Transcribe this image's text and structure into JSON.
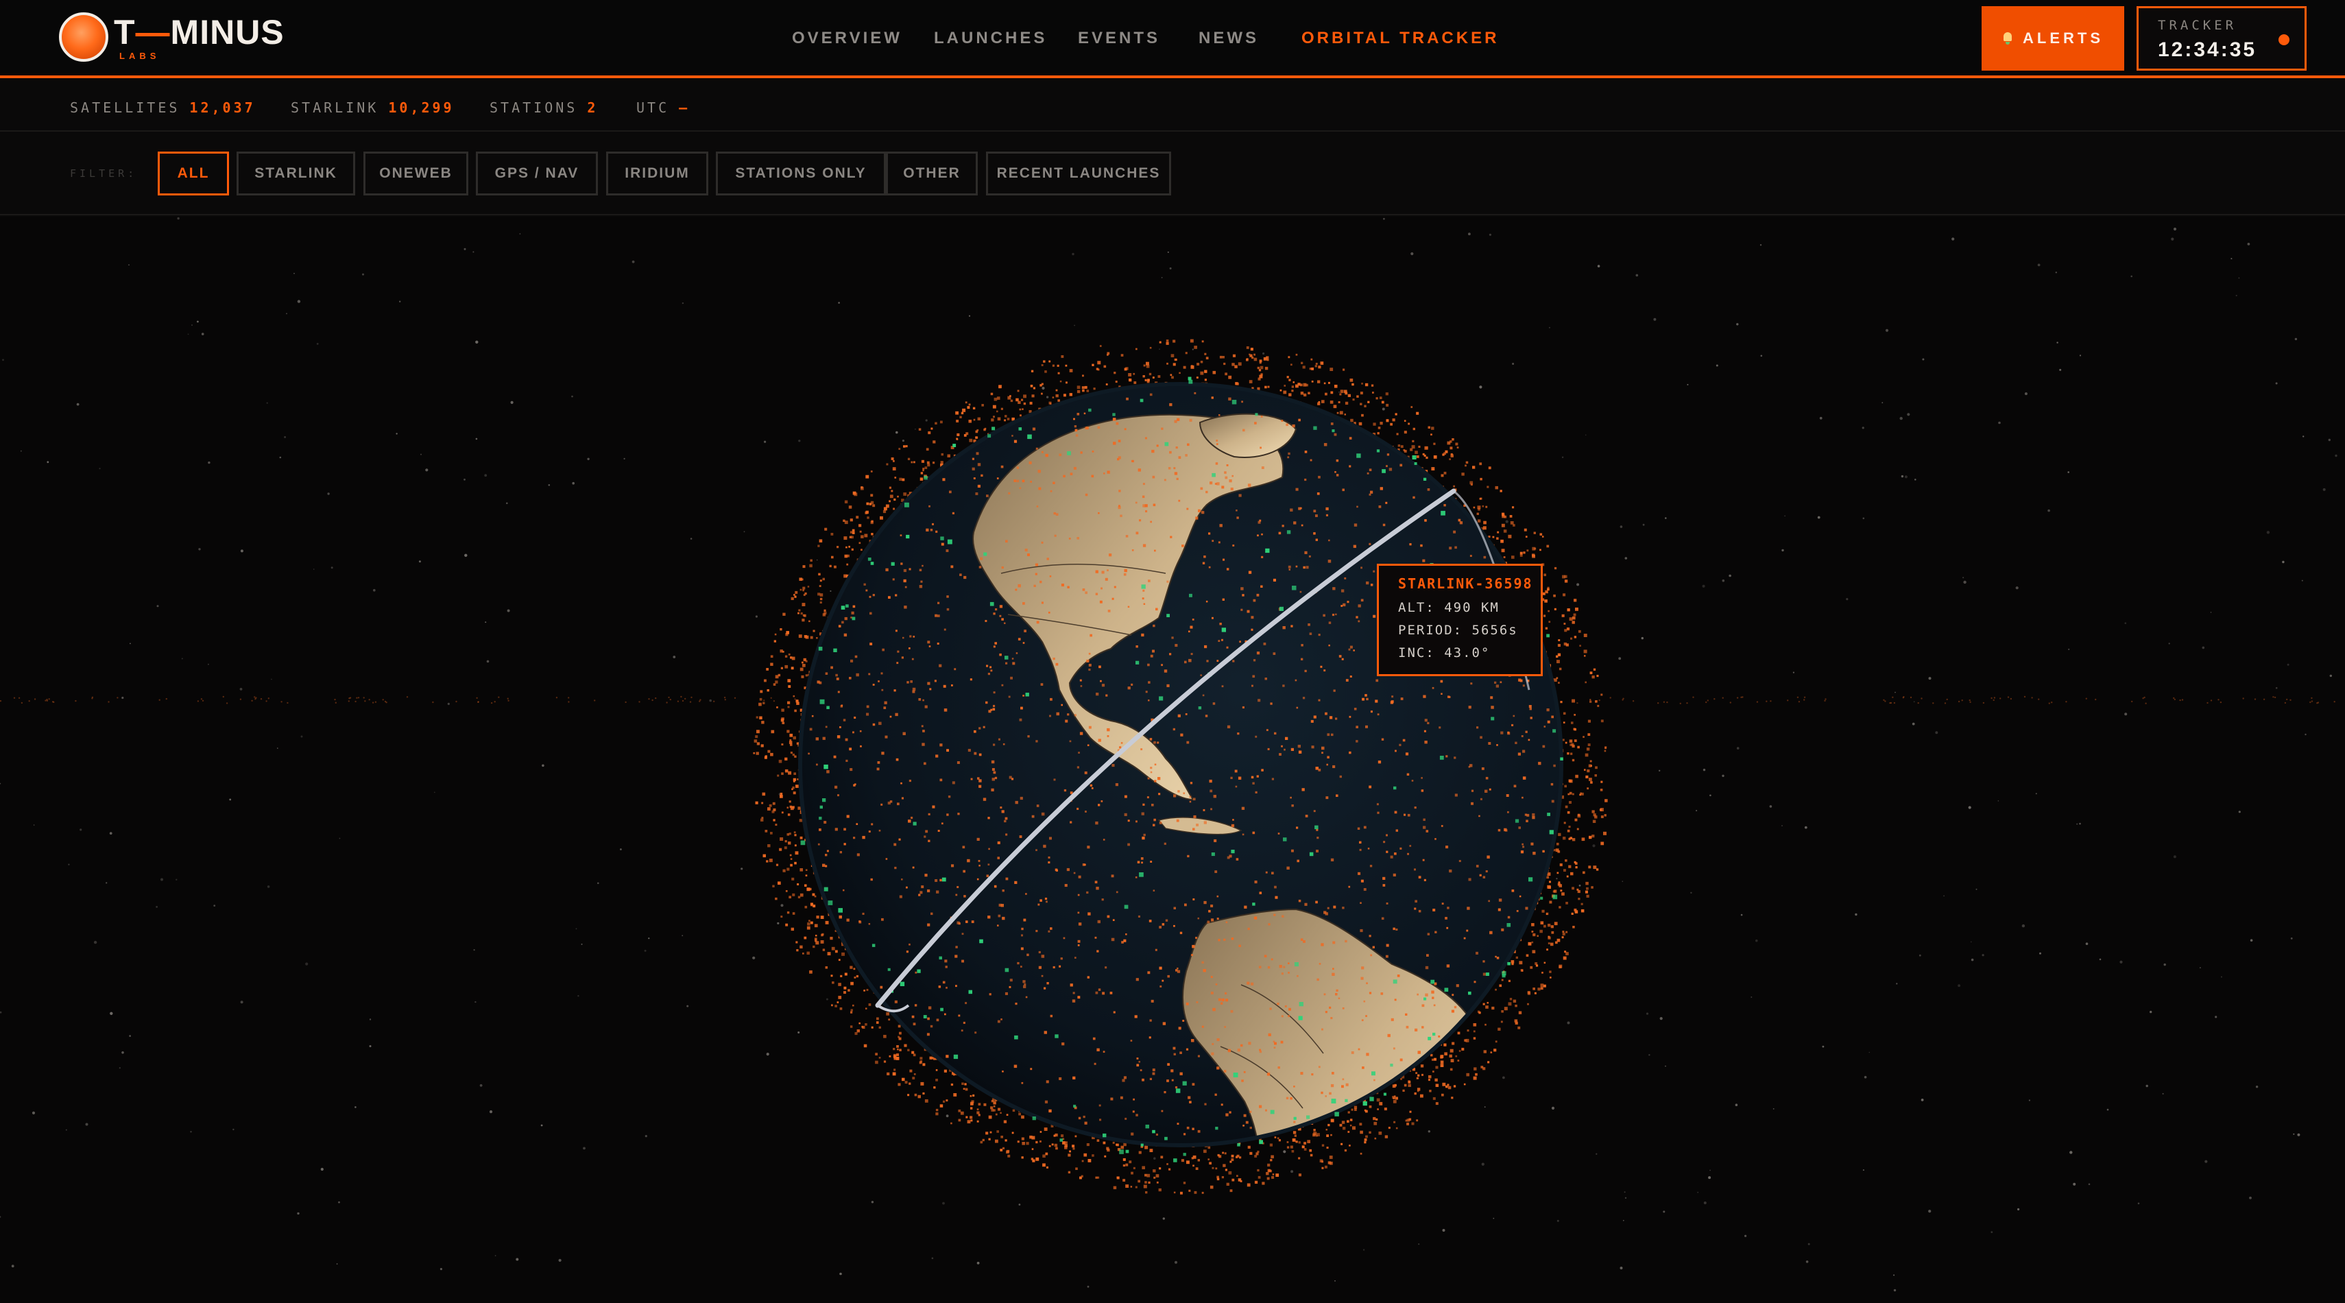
{
  "brand": {
    "name_left": "T",
    "name_dash": "—",
    "name_right": "MINUS",
    "sub": "LABS"
  },
  "nav": [
    {
      "label": "OVERVIEW",
      "active": false
    },
    {
      "label": "LAUNCHES",
      "active": false
    },
    {
      "label": "EVENTS",
      "active": false
    },
    {
      "label": "NEWS",
      "active": false
    },
    {
      "label": "ORBITAL TRACKER",
      "active": true
    }
  ],
  "alerts": {
    "label": "ALERTS",
    "icon": "bell-icon"
  },
  "tracker": {
    "label": "TRACKER",
    "time": "12:34:35"
  },
  "stats": {
    "satellites": {
      "label": "SATELLITES",
      "value": "12,037"
    },
    "starlink": {
      "label": "STARLINK",
      "value": "10,299"
    },
    "stations": {
      "label": "STATIONS",
      "value": "2"
    },
    "utc": {
      "label": "UTC",
      "value": "—"
    }
  },
  "filters": {
    "label": "FILTER:",
    "chips": [
      "ALL",
      "STARLINK",
      "ONEWEB",
      "GPS / NAV",
      "IRIDIUM",
      "STATIONS ONLY",
      "OTHER",
      "RECENT LAUNCHES"
    ],
    "active": "ALL"
  },
  "tooltip": {
    "name": "STARLINK-36598",
    "alt": "ALT: 490 KM",
    "period": "PERIOD: 5656s",
    "inc": "INC: 43.0°"
  },
  "colors": {
    "accent": "#ff5a0a",
    "satellite_dot": "#f06a22",
    "station_dot": "#2fd37a",
    "land": "#d9c19a",
    "ocean": "#0c1620",
    "orbit_path": "#c8ccd6"
  }
}
